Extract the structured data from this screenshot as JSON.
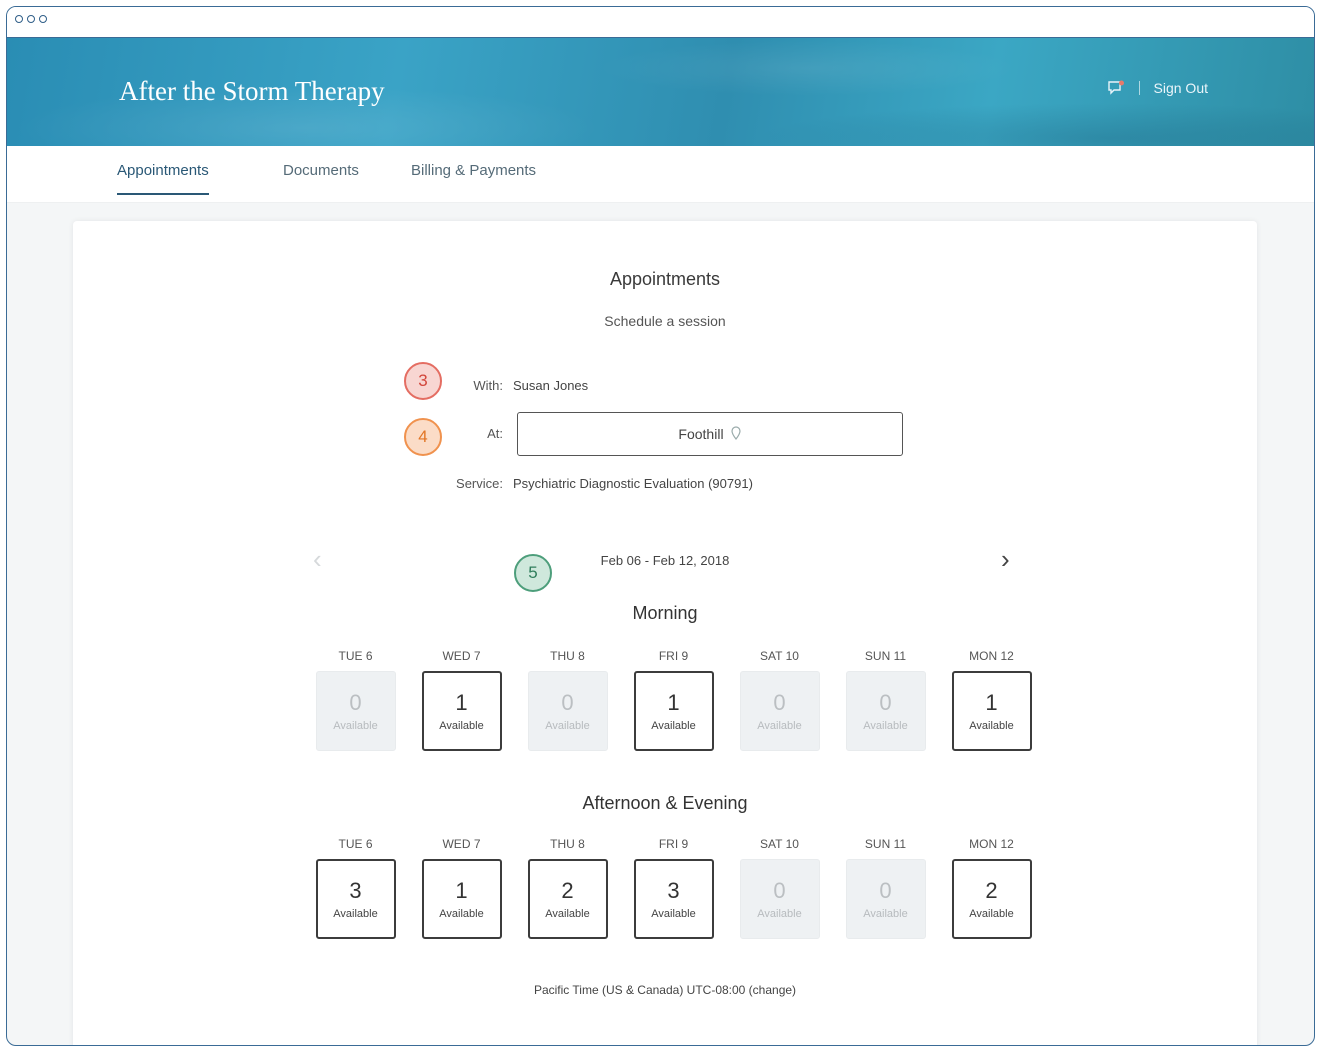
{
  "window": {
    "dots": [
      "●",
      "●",
      "●"
    ]
  },
  "header": {
    "brand": "After the Storm Therapy",
    "sign_out": "Sign Out"
  },
  "tabs": [
    {
      "label": "Appointments",
      "active": true
    },
    {
      "label": "Documents",
      "active": false
    },
    {
      "label": "Billing & Payments",
      "active": false
    }
  ],
  "card": {
    "title": "Appointments",
    "subtitle": "Schedule a session",
    "badges": {
      "with": "3",
      "at": "4",
      "dates": "5"
    },
    "with_label": "With:",
    "with_value": "Susan Jones",
    "at_label": "At:",
    "location": "Foothill",
    "service_label": "Service:",
    "service_value": "Psychiatric Diagnostic Evaluation (90791)",
    "date_range": "Feb 06 - Feb 12, 2018",
    "prev_icon": "chevron-left-icon",
    "next_icon": "chevron-right-icon",
    "morning_title": "Morning",
    "afternoon_title": "Afternoon & Evening",
    "available_label": "Available",
    "days": [
      "TUE 6",
      "WED 7",
      "THU 8",
      "FRI 9",
      "SAT 10",
      "SUN 11",
      "MON 12"
    ],
    "morning_counts": [
      "0",
      "1",
      "0",
      "1",
      "0",
      "0",
      "1"
    ],
    "afternoon_counts": [
      "3",
      "1",
      "2",
      "3",
      "0",
      "0",
      "2"
    ],
    "timezone": "Pacific Time (US & Canada) UTC-08:00 (change)"
  },
  "colors": {
    "header_teal": "#2f93b8",
    "tab_active": "#2a5876",
    "badge3": "#e46d62",
    "badge4": "#f0924e",
    "badge5": "#4d9e7b"
  }
}
